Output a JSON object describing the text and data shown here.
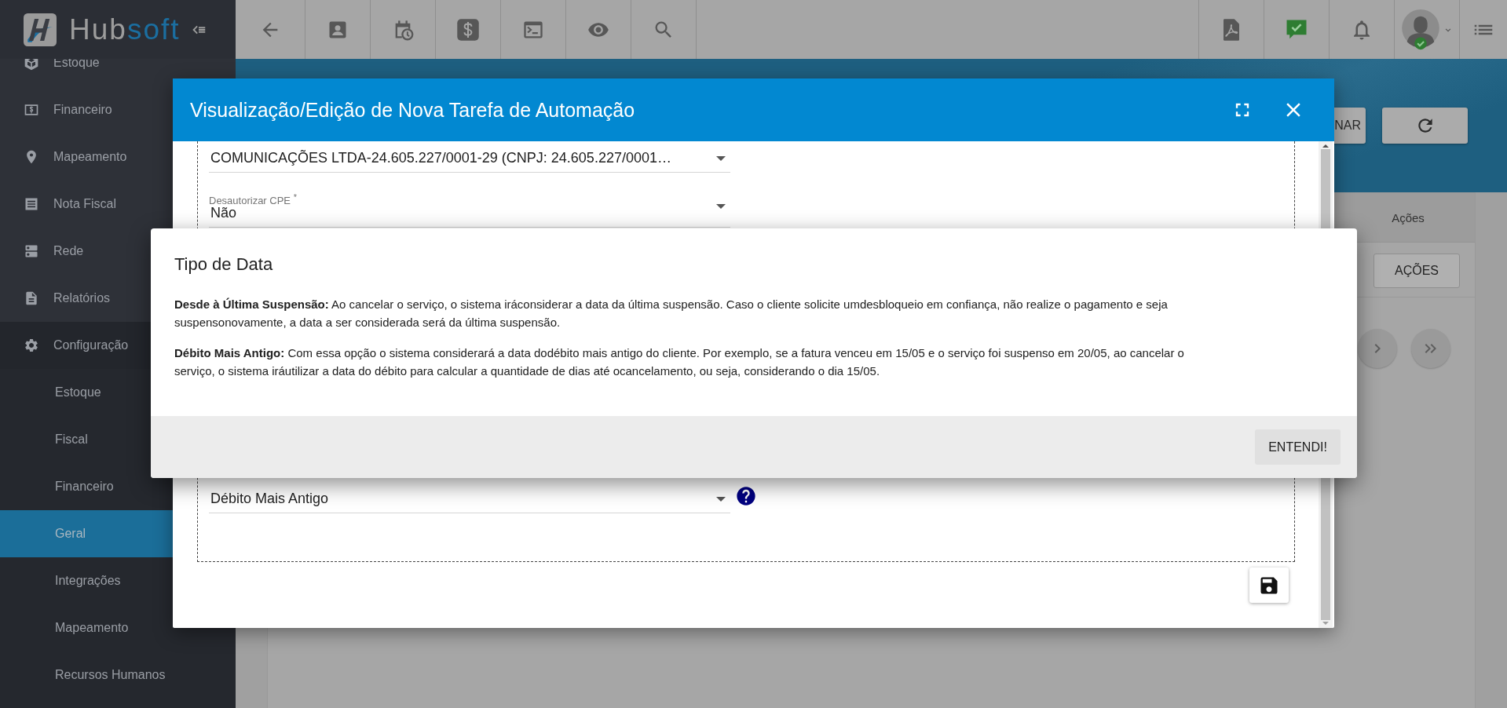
{
  "logo": {
    "text": "Hub",
    "accent": "soft"
  },
  "sidebar": {
    "items": [
      {
        "label": "Estoque",
        "selected": false
      },
      {
        "label": "Financeiro",
        "selected": false
      },
      {
        "label": "Mapeamento",
        "selected": false
      },
      {
        "label": "Nota Fiscal",
        "selected": false
      },
      {
        "label": "Rede",
        "selected": false
      },
      {
        "label": "Relatórios",
        "selected": false
      },
      {
        "label": "Configuração",
        "selected": false,
        "expanded": true,
        "children": [
          {
            "label": "Estoque",
            "selected": false
          },
          {
            "label": "Fiscal",
            "selected": false
          },
          {
            "label": "Financeiro",
            "selected": false
          },
          {
            "label": "Geral",
            "selected": true
          },
          {
            "label": "Integrações",
            "selected": false
          },
          {
            "label": "Mapeamento",
            "selected": false
          },
          {
            "label": "Recursos Humanos",
            "selected": false
          }
        ]
      }
    ]
  },
  "page": {
    "top_buttons": [
      {
        "label": "NAR"
      }
    ],
    "column_header": "Ações",
    "actions_button": "AÇÕES"
  },
  "modal": {
    "title": "Visualização/Edição de Nova Tarefa de Automação",
    "fields": [
      {
        "value": "COMUNICAÇÕES LTDA-24.605.227/0001-29 (CNPJ: 24.605.227/0001…"
      },
      {
        "label": "Desautorizar CPE $^{*}$",
        "value": "Não"
      },
      {
        "value": "Débito Mais Antigo",
        "help": true
      }
    ]
  },
  "dialog": {
    "title": "Tipo de Data",
    "paragraphs": [
      "**Desde à Última Suspensão:** Ao cancelar o serviço, o sistema iráconsiderar a data da última suspensão. Caso o cliente solicite umdesbloqueio em confiança, não realize o pagamento e seja suspensonovamente, a data a ser considerada será da última suspensão.",
      "**Débito Mais Antigo:** Com essa opção o sistema considerará a data dodébito mais antigo do cliente. Por exemplo, se a fatura venceu em 15/05 e o serviço foi suspenso em 20/05, ao cancelar o serviço, o sistema iráutilizar a data do débito para calcular a quantidade de dias até ocancelamento, ou seja, considerando o dia 15/05."
    ],
    "button": "ENTENDI!"
  }
}
